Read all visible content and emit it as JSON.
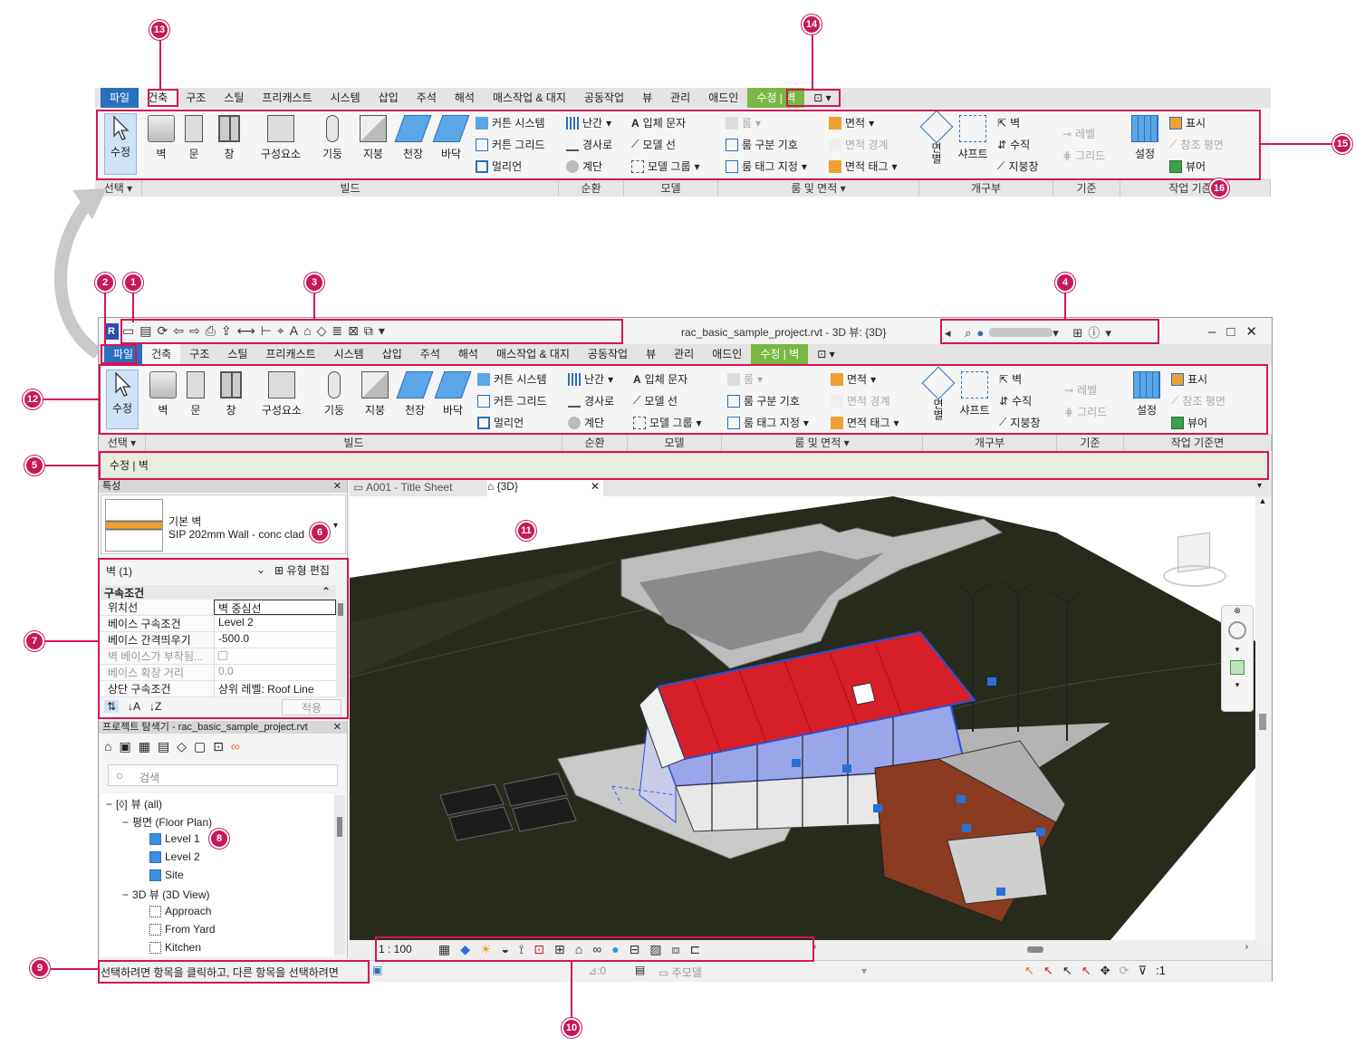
{
  "top_ribbon": {
    "tabs": [
      "파일",
      "건축",
      "구조",
      "스틸",
      "프리캐스트",
      "시스템",
      "삽입",
      "주석",
      "해석",
      "매스작업 & 대지",
      "공동작업",
      "뷰",
      "관리",
      "애드인",
      "수정 | 벽"
    ],
    "panels": [
      "선택 ▾",
      "빌드",
      "순환",
      "모델",
      "룸 및 면적 ▾",
      "개구부",
      "기준",
      "작업 기준면"
    ]
  },
  "ribbon_buttons": {
    "modify": "수정",
    "wall": "벽",
    "door": "문",
    "window": "창",
    "component": "구성요소",
    "column": "기둥",
    "roof": "지붕",
    "ceiling": "천장",
    "floor": "바닥",
    "curtain_system": "커튼 시스템",
    "curtain_grid": "커튼 그리드",
    "mullion": "멀리언",
    "railing": "난간",
    "ramp": "경사로",
    "stair": "계단",
    "model_text": "입체 문자",
    "model_line": "모델 선",
    "model_group": "모델 그룹",
    "room": "룸",
    "room_separator": "룸 구분 기호",
    "tag_room": "룸 태그 지정",
    "area": "면적",
    "area_boundary": "면적 경계",
    "tag_area": "면적 태그",
    "by_face": "면별",
    "shaft": "샤프트",
    "wall_opening": "벽",
    "vertical": "수직",
    "dormer": "지붕창",
    "level": "레벨",
    "grid": "그리드",
    "set": "설정",
    "show": "표시",
    "ref_plane": "참조 평면",
    "viewer": "뷰어"
  },
  "window": {
    "title": "rac_basic_sample_project.rvt - 3D 뷰: {3D}",
    "context_bar": "수정 | 벽"
  },
  "properties": {
    "header": "특성",
    "type_family": "기본 벽",
    "type_name": "SIP 202mm Wall - conc clad",
    "filter": "벽 (1)",
    "edit_type": "유형 편집",
    "group": "구속조건",
    "rows": [
      {
        "k": "위치선",
        "v": "벽 중심선"
      },
      {
        "k": "베이스 구속조건",
        "v": "Level 2"
      },
      {
        "k": "베이스 간격띄우기",
        "v": "-500.0"
      },
      {
        "k": "벽 베이스가 부착됨...",
        "v": ""
      },
      {
        "k": "베이스 확장 거리",
        "v": "0.0"
      },
      {
        "k": "상단 구속조건",
        "v": "상위 레벨: Roof Line"
      }
    ],
    "apply": "적용"
  },
  "browser": {
    "title": "프로젝트 탐색기 - rac_basic_sample_project.rvt",
    "search_placeholder": "검색",
    "root": "뷰 (all)",
    "floor_plan": "평면 (Floor Plan)",
    "floor_items": [
      "Level 1",
      "Level 2",
      "Site"
    ],
    "view_3d": "3D 뷰 (3D View)",
    "view_3d_items": [
      "Approach",
      "From Yard",
      "Kitchen"
    ]
  },
  "view_tabs": [
    "A001 - Title Sheet",
    "{3D}"
  ],
  "view_control": {
    "scale": "1 : 100"
  },
  "status": {
    "message": "선택하려면 항목을 클릭하고, 다른 항목을 선택하려면 ",
    "workset": ":0",
    "model": "주모델",
    "filter_count": ":1"
  },
  "callouts": [
    "1",
    "2",
    "3",
    "4",
    "5",
    "6",
    "7",
    "8",
    "9",
    "10",
    "11",
    "12",
    "13",
    "14",
    "15",
    "16"
  ],
  "colors": {
    "callout": "#d4145a",
    "file_tab": "#2a6fbd",
    "context_tab": "#79b842",
    "roof": "#d61f26"
  }
}
